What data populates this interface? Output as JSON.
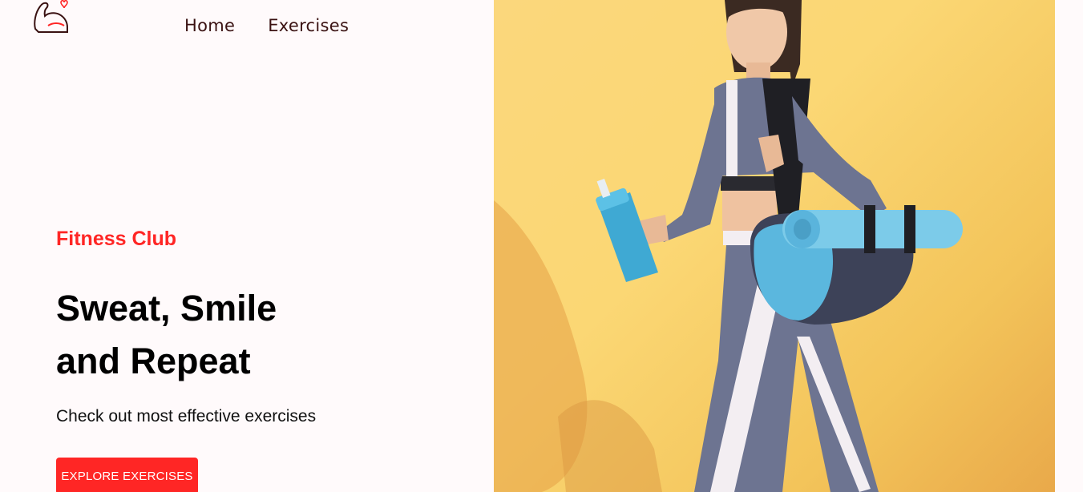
{
  "navbar": {
    "logo_icon": "flexed-arm-heart-icon",
    "links": [
      {
        "label": "Home"
      },
      {
        "label": "Exercises"
      }
    ]
  },
  "hero": {
    "eyebrow": "Fitness Club",
    "headline_line1": "Sweat, Smile",
    "headline_line2": "and Repeat",
    "subtext": "Check out most effective exercises",
    "cta_label": "EXPLORE EXERCISES",
    "image_alt": "Woman walking with shaker bottle and yoga mat bag",
    "image_icon": "athlete-photo"
  },
  "colors": {
    "accent": "#ff2625",
    "background": "#fffafb",
    "nav_text": "#3a1212",
    "hero_image_bg": "#fbd77c"
  }
}
